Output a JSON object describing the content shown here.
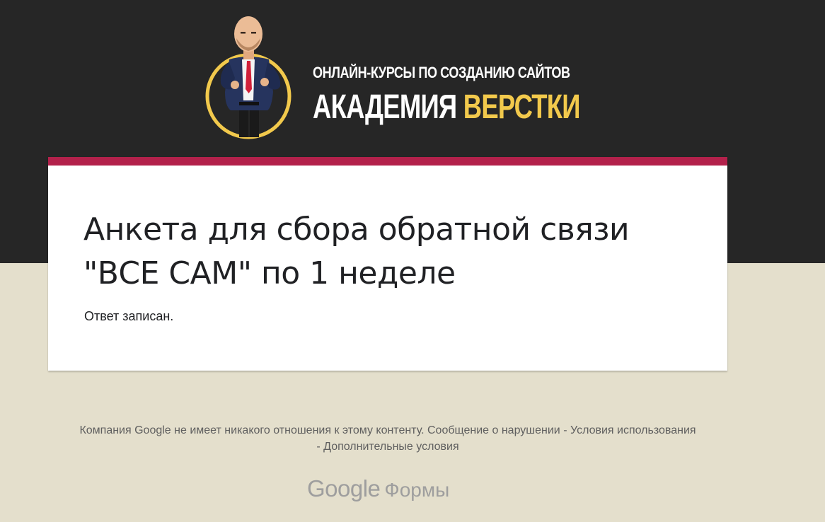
{
  "header": {
    "subtitle": "ОНЛАЙН-КУРСЫ ПО СОЗДАНИЮ САЙТОВ",
    "title_main": "АКАДЕМИЯ",
    "title_accent": "ВЕРСТКИ",
    "background_color": "#262626",
    "accent_color": "#f2c94c"
  },
  "form": {
    "title": "Анкета для сбора обратной связи \"ВСЕ САМ\" по 1 неделе",
    "confirmation": "Ответ записан.",
    "accent_bar_color": "#b3214b"
  },
  "footer": {
    "disclaimer": "Компания Google не имеет никакого отношения к этому контенту.",
    "report_abuse": "Сообщение о нарушении",
    "separator": " - ",
    "terms": "Условия использования",
    "additional_terms": "Дополнительные условия",
    "brand_google": "Google",
    "brand_forms": "Формы"
  },
  "page": {
    "background_color": "#e4dfcc"
  }
}
